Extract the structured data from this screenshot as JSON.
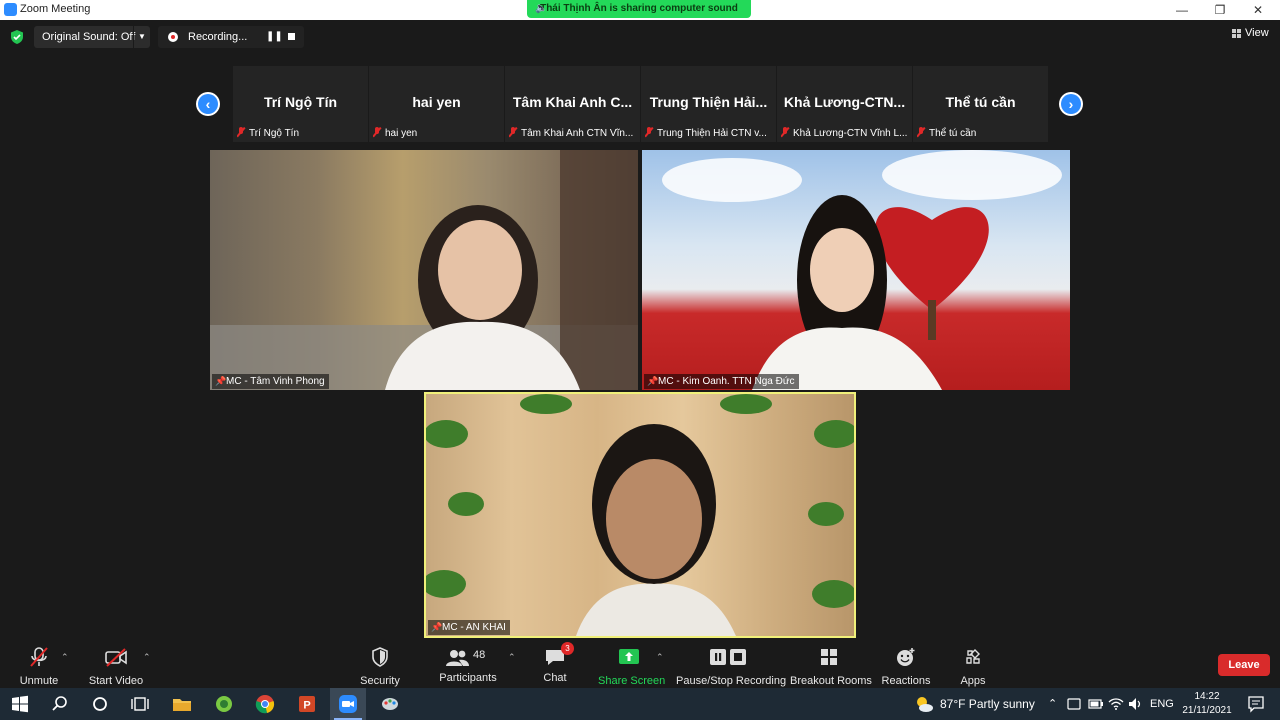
{
  "window": {
    "title": "Zoom Meeting",
    "share_banner": "Thái Thịnh Ân is sharing computer sound"
  },
  "topbar": {
    "original_sound": "Original Sound: Off",
    "recording": "Recording...",
    "view": "View"
  },
  "gallery": {
    "tiles": [
      {
        "display": "Trí Ngộ Tín",
        "name": "Trí Ngộ Tín"
      },
      {
        "display": "hai yen",
        "name": "hai yen"
      },
      {
        "display": "Tâm  Khai  Anh  C...",
        "name": "Tâm Khai Anh CTN Vĩn..."
      },
      {
        "display": "Trung  Thiện  Hải...",
        "name": "Trung Thiện Hải CTN v..."
      },
      {
        "display": "Khả  Lương-CTN...",
        "name": "Khả Lương-CTN Vĩnh L..."
      },
      {
        "display": "Thể tú cần",
        "name": "Thể tú cần"
      }
    ]
  },
  "videos": [
    {
      "name": "MC - Tâm Vinh Phong"
    },
    {
      "name": "MC - Kim Oanh. TTN Nga Đức"
    },
    {
      "name": "MC - AN KHAI"
    }
  ],
  "toolbar": {
    "unmute": "Unmute",
    "start_video": "Start Video",
    "security": "Security",
    "participants": "Participants",
    "participants_count": "48",
    "chat": "Chat",
    "chat_badge": "3",
    "share_screen": "Share Screen",
    "pause_stop_recording": "Pause/Stop Recording",
    "breakout_rooms": "Breakout Rooms",
    "reactions": "Reactions",
    "apps": "Apps",
    "leave": "Leave"
  },
  "taskbar": {
    "weather": "87°F  Partly sunny",
    "language": "ENG",
    "time": "14:22",
    "date": "21/11/2021"
  },
  "colors": {
    "accent": "#2d8cff",
    "share_green": "#23d959",
    "leave_red": "#d92b2b",
    "active_speaker": "#f0f07a"
  }
}
